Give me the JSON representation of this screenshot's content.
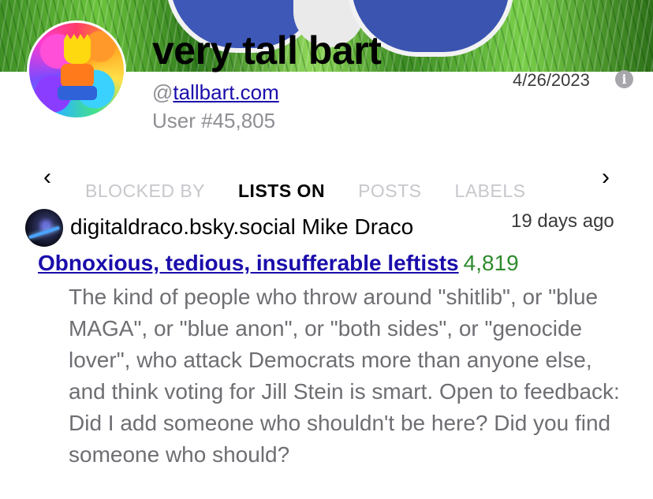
{
  "profile": {
    "display_name": "very tall bart",
    "handle_prefix": "@",
    "handle": "tallbart.com",
    "user_number": "User #45,805",
    "joined_date": "4/26/2023",
    "info_icon_glyph": "i"
  },
  "tabs": {
    "prev_glyph": "‹",
    "next_glyph": "›",
    "items": [
      {
        "label": "BLOCKED BY",
        "active": false
      },
      {
        "label": "LISTS ON",
        "active": true
      },
      {
        "label": "POSTS",
        "active": false
      },
      {
        "label": "LABELS",
        "active": false
      }
    ]
  },
  "list_entry": {
    "author": "digitaldraco.bsky.social Mike Draco",
    "time_ago": "19 days ago",
    "title": "Obnoxious, tedious, insufferable leftists",
    "member_count": "4,819",
    "description": "The kind of people who throw around \"shitlib\", or \"blue MAGA\", or \"blue anon\", or \"both sides\", or \"genocide lover\", who attack Democrats more than anyone else, and think voting for Jill Stein is smart. Open to feedback: Did I add someone who shouldn't be here? Did you find someone who should?"
  },
  "colors": {
    "link": "#1a0dab",
    "count": "#2e8b2e",
    "muted_text": "#8e8e93",
    "inactive_tab": "#c7c7cc"
  }
}
